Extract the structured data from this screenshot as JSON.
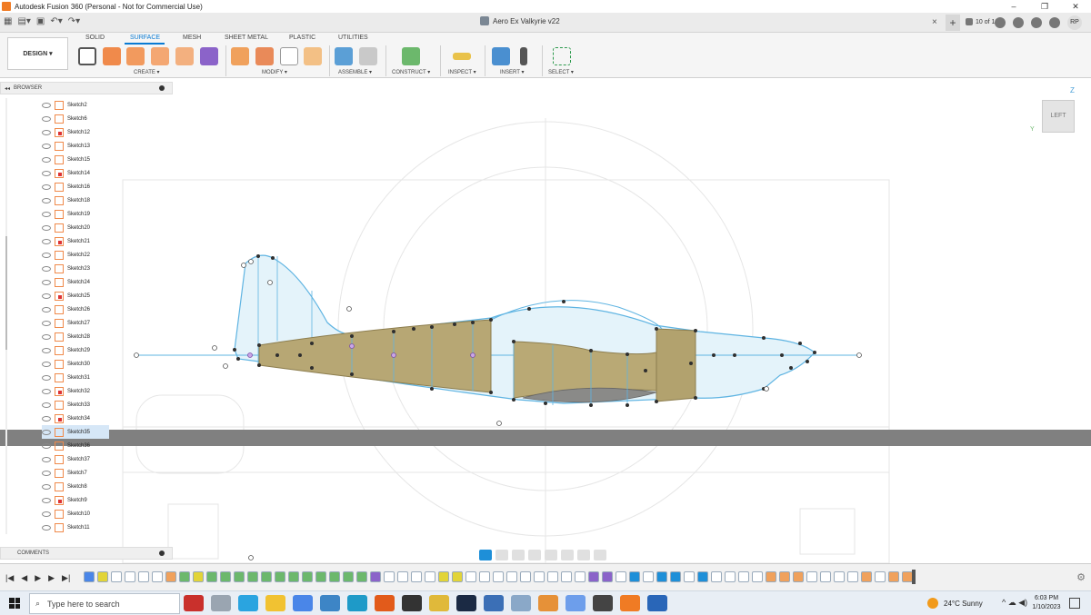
{
  "window": {
    "title": "Autodesk Fusion 360 (Personal - Not for Commercial Use)",
    "controls": [
      "–",
      "❐",
      "✕"
    ]
  },
  "doc": {
    "tab_title": "Aero Ex Valkyrie v22",
    "close": "×",
    "plus": "+",
    "tab_count": "10 of 10",
    "avatar": "RP"
  },
  "toolbar": {
    "design_label": "DESIGN ▾",
    "tabs": [
      "SOLID",
      "SURFACE",
      "MESH",
      "SHEET METAL",
      "PLASTIC",
      "UTILITIES"
    ],
    "active_tab": "SURFACE",
    "groups": [
      "CREATE ▾",
      "MODIFY ▾",
      "ASSEMBLE ▾",
      "CONSTRUCT ▾",
      "INSPECT ▾",
      "INSERT ▾",
      "SELECT ▾"
    ]
  },
  "browser": {
    "title": "BROWSER",
    "collapse": "◂◂",
    "items": [
      {
        "label": "Sketch2",
        "red": false
      },
      {
        "label": "Sketch6",
        "red": false
      },
      {
        "label": "Sketch12",
        "red": true
      },
      {
        "label": "Sketch13",
        "red": false
      },
      {
        "label": "Sketch15",
        "red": false
      },
      {
        "label": "Sketch14",
        "red": true
      },
      {
        "label": "Sketch16",
        "red": false
      },
      {
        "label": "Sketch18",
        "red": false
      },
      {
        "label": "Sketch19",
        "red": false
      },
      {
        "label": "Sketch20",
        "red": false
      },
      {
        "label": "Sketch21",
        "red": true
      },
      {
        "label": "Sketch22",
        "red": false
      },
      {
        "label": "Sketch23",
        "red": false
      },
      {
        "label": "Sketch24",
        "red": false
      },
      {
        "label": "Sketch25",
        "red": true
      },
      {
        "label": "Sketch26",
        "red": false
      },
      {
        "label": "Sketch27",
        "red": false
      },
      {
        "label": "Sketch28",
        "red": false
      },
      {
        "label": "Sketch29",
        "red": false
      },
      {
        "label": "Sketch30",
        "red": false
      },
      {
        "label": "Sketch31",
        "red": false
      },
      {
        "label": "Sketch32",
        "red": true
      },
      {
        "label": "Sketch33",
        "red": false
      },
      {
        "label": "Sketch34",
        "red": true
      },
      {
        "label": "Sketch35",
        "red": false
      },
      {
        "label": "Sketch36",
        "red": false
      },
      {
        "label": "Sketch37",
        "red": false
      },
      {
        "label": "Sketch7",
        "red": false
      },
      {
        "label": "Sketch8",
        "red": false
      },
      {
        "label": "Sketch9",
        "red": true
      },
      {
        "label": "Sketch10",
        "red": false
      },
      {
        "label": "Sketch11",
        "red": false
      }
    ],
    "selected": "Sketch35"
  },
  "comments": {
    "title": "COMMENTS"
  },
  "viewcube": {
    "face": "LEFT",
    "axis_z": "Z",
    "axis_y": "Y"
  },
  "timeline": {
    "controls": [
      "|◀",
      "◀",
      "▶",
      "▶",
      "▶|"
    ],
    "gear": "⚙"
  },
  "taskbar": {
    "search_placeholder": "Type here to search",
    "search_icon": "⌕",
    "weather": "24°C  Sunny",
    "time": "6:03 PM",
    "date": "1/10/2023",
    "tray": "^ ☁ ◀)"
  },
  "colors": {
    "accent": "#0a7bd3",
    "fuselage": "#b7a774",
    "sketch_line": "#5fb4e2",
    "sketch_fill": "#e4f3fa",
    "ground_band": "#7f7f7f"
  }
}
